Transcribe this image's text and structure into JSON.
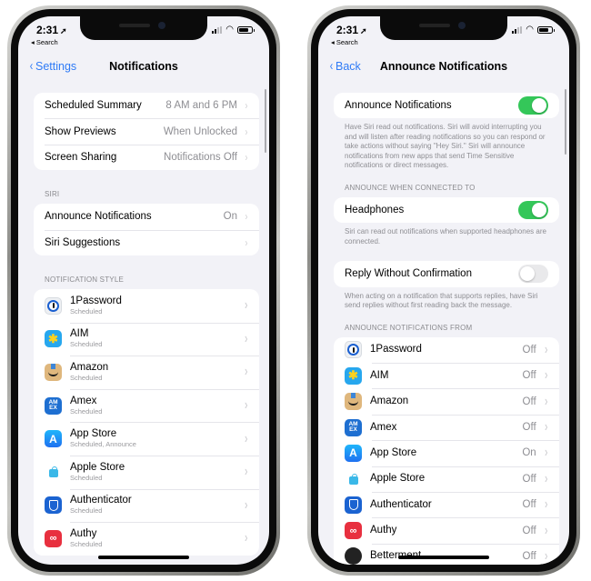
{
  "status_bar": {
    "time": "2:31",
    "location_icon": "location-arrow-icon",
    "back_app": "◂ Search",
    "signal_icon": "cellular-signal-icon",
    "wifi_icon": "wifi-icon",
    "battery_icon": "battery-icon"
  },
  "left_screen": {
    "nav": {
      "back_label": "Settings",
      "title": "Notifications"
    },
    "general_rows": [
      {
        "label": "Scheduled Summary",
        "value": "8 AM and 6 PM"
      },
      {
        "label": "Show Previews",
        "value": "When Unlocked"
      },
      {
        "label": "Screen Sharing",
        "value": "Notifications Off"
      }
    ],
    "siri_header": "SIRI",
    "siri_rows": [
      {
        "label": "Announce Notifications",
        "value": "On"
      },
      {
        "label": "Siri Suggestions",
        "value": ""
      }
    ],
    "style_header": "NOTIFICATION STYLE",
    "apps": [
      {
        "name": "1Password",
        "sub": "Scheduled",
        "icon": "1password-icon"
      },
      {
        "name": "AIM",
        "sub": "Scheduled",
        "icon": "aim-icon"
      },
      {
        "name": "Amazon",
        "sub": "Scheduled",
        "icon": "amazon-icon"
      },
      {
        "name": "Amex",
        "sub": "Scheduled",
        "icon": "amex-icon"
      },
      {
        "name": "App Store",
        "sub": "Scheduled, Announce",
        "icon": "app-store-icon"
      },
      {
        "name": "Apple Store",
        "sub": "Scheduled",
        "icon": "apple-store-icon"
      },
      {
        "name": "Authenticator",
        "sub": "Scheduled",
        "icon": "authenticator-icon"
      },
      {
        "name": "Authy",
        "sub": "Scheduled",
        "icon": "authy-icon"
      }
    ]
  },
  "right_screen": {
    "nav": {
      "back_label": "Back",
      "title": "Announce Notifications"
    },
    "announce": {
      "label": "Announce Notifications",
      "enabled": true,
      "footer": "Have Siri read out notifications. Siri will avoid interrupting you and will listen after reading notifications so you can respond or take actions without saying \"Hey Siri.\" Siri will announce notifications from new apps that send Time Sensitive notifications or direct messages."
    },
    "connected_header": "ANNOUNCE WHEN CONNECTED TO",
    "headphones": {
      "label": "Headphones",
      "enabled": true,
      "footer": "Siri can read out notifications when supported headphones are connected."
    },
    "reply": {
      "label": "Reply Without Confirmation",
      "enabled": false,
      "footer": "When acting on a notification that supports replies, have Siri send replies without first reading back the message."
    },
    "from_header": "ANNOUNCE NOTIFICATIONS FROM",
    "apps": [
      {
        "name": "1Password",
        "value": "Off"
      },
      {
        "name": "AIM",
        "value": "Off"
      },
      {
        "name": "Amazon",
        "value": "Off"
      },
      {
        "name": "Amex",
        "value": "Off"
      },
      {
        "name": "App Store",
        "value": "On"
      },
      {
        "name": "Apple Store",
        "value": "Off"
      },
      {
        "name": "Authenticator",
        "value": "Off"
      },
      {
        "name": "Authy",
        "value": "Off"
      },
      {
        "name": "Betterment",
        "value": "Off"
      }
    ]
  },
  "glyphs": {
    "chevron_right": "›",
    "chevron_left": "‹",
    "location": "➚",
    "wifi": "≋",
    "aim": "🏃",
    "amex": "AM EX",
    "app_store": "A",
    "authy": "∞"
  }
}
